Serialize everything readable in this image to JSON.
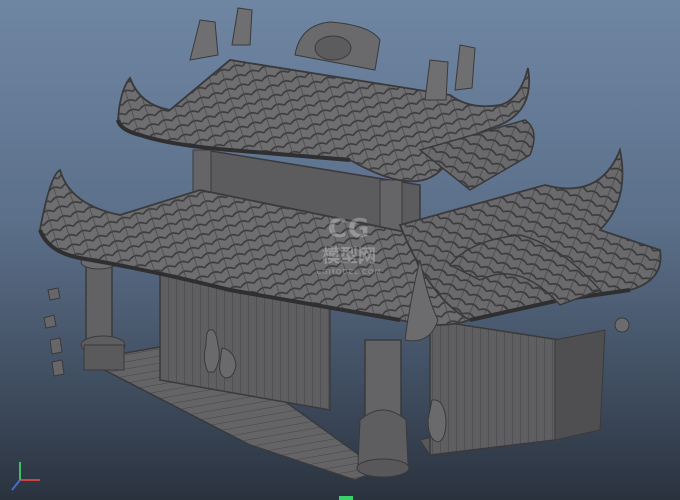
{
  "viewport": {
    "background_top": "#6f86a3",
    "background_bottom": "#2a323e",
    "model_color": "#6a6a6c"
  },
  "watermark": {
    "logo": "CG",
    "text": "模型网",
    "sub": "CGMODEL.COM"
  },
  "icons": [
    "pagoda-model",
    "axis-indicator"
  ]
}
